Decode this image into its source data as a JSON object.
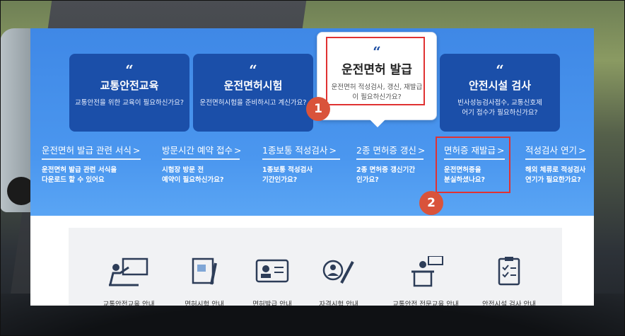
{
  "cards": [
    {
      "title": "교통안전교육",
      "desc": "교통안전을 위한 교육이 필요하신가요?"
    },
    {
      "title": "운전면허시험",
      "desc": "운전면허시험을 준비하시고 계신가요?"
    },
    {
      "title": "운전면허 발급",
      "desc": "운전면허 적성검사, 갱신, 재발급이 필요하신가요?"
    },
    {
      "title": "안전시설 검사",
      "desc": "빈사성능검사접수, 교통신호제어기 접수가 필요하신가요?"
    }
  ],
  "quote_mark": "“",
  "arrow": ">",
  "links": [
    {
      "title": "운전면허 발급 관련 서식",
      "desc1": "운전면허 발급 관련 서식을",
      "desc2": "다운로드 할 수 있어요"
    },
    {
      "title": "방문시간 예약 접수",
      "desc1": "시험장 방문 전",
      "desc2": "예약이 필요하신가요?"
    },
    {
      "title": "1종보통 적성검사",
      "desc1": "1종보통 적성검사",
      "desc2": "기간인가요?"
    },
    {
      "title": "2종 면허증 갱신",
      "desc1": "2종 면허증 갱신기간",
      "desc2": "인가요?"
    },
    {
      "title": "면허증 재발급",
      "desc1": "운전면허증을",
      "desc2": "분실하셨나요?"
    },
    {
      "title": "적성검사 연기",
      "desc1": "해외 체류로 적성검사",
      "desc2": "연기가 필요한가요?"
    }
  ],
  "badges": {
    "one": "1",
    "two": "2"
  },
  "services": [
    {
      "label": "교통안전교육 안내",
      "icon": "teacher-board-icon"
    },
    {
      "label": "면허시험 안내",
      "icon": "exam-paper-icon"
    },
    {
      "label": "면허발급 안내",
      "icon": "license-card-icon"
    },
    {
      "label": "자격시험 안내",
      "icon": "certificate-pen-icon"
    },
    {
      "label": "교통안전 전문교육 안내",
      "icon": "lecturer-podium-icon"
    },
    {
      "label": "안전시설 검사 안내",
      "icon": "checklist-icon"
    }
  ],
  "colors": {
    "hero_top": "#3f88e6",
    "card_bg": "#1b4fa9",
    "highlight": "#e03232",
    "badge": "#d9533b"
  }
}
